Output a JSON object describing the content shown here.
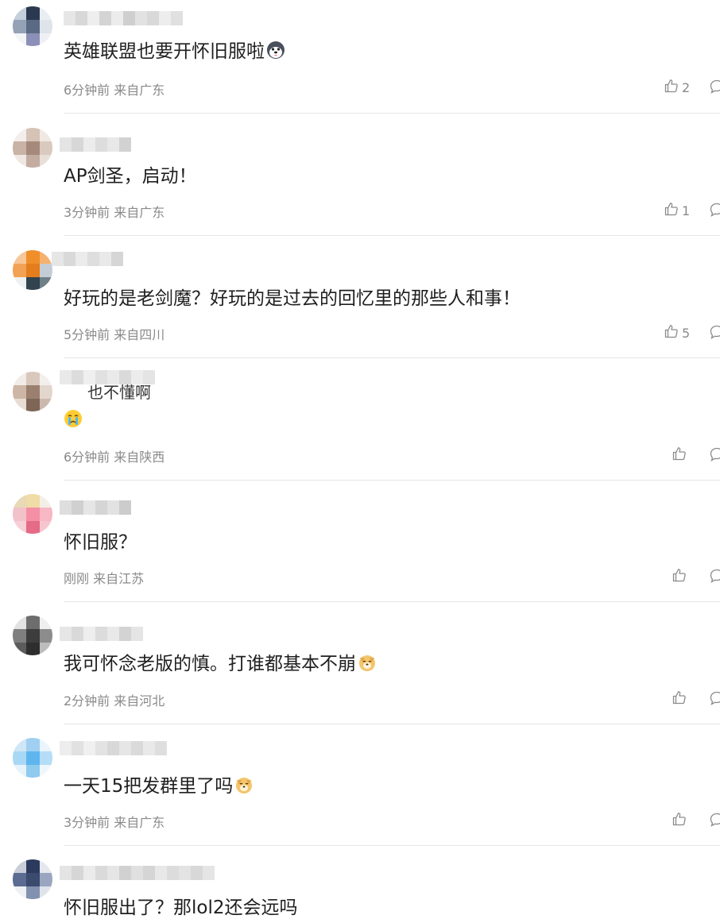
{
  "comments": [
    {
      "text": "英雄联盟也要开怀旧服啦",
      "emoji": "husky-emoji",
      "time": "6分钟前",
      "location": "来自广东",
      "likes": "2"
    },
    {
      "text": "AP剑圣，启动！",
      "emoji": "",
      "time": "3分钟前",
      "location": "来自广东",
      "likes": "1"
    },
    {
      "text": "好玩的是老剑魔？好玩的是过去的回忆里的那些人和事！",
      "emoji": "",
      "time": "5分钟前",
      "location": "来自四川",
      "likes": "5"
    },
    {
      "text": "",
      "emoji": "crying-emoji",
      "name_fragment": "也不懂啊",
      "time": "6分钟前",
      "location": "来自陕西",
      "likes": ""
    },
    {
      "text": "怀旧服？",
      "emoji": "",
      "time": "刚刚",
      "location": "来自江苏",
      "likes": ""
    },
    {
      "text": "我可怀念老版的慎。打谁都基本不崩",
      "emoji": "doge-emoji",
      "time": "2分钟前",
      "location": "来自河北",
      "likes": ""
    },
    {
      "text": "一天15把发群里了吗",
      "emoji": "doge-emoji",
      "time": "3分钟前",
      "location": "来自广东",
      "likes": ""
    },
    {
      "text": "怀旧服出了？那lol2还会远吗",
      "emoji": "",
      "time": "",
      "location": "",
      "likes": ""
    }
  ]
}
